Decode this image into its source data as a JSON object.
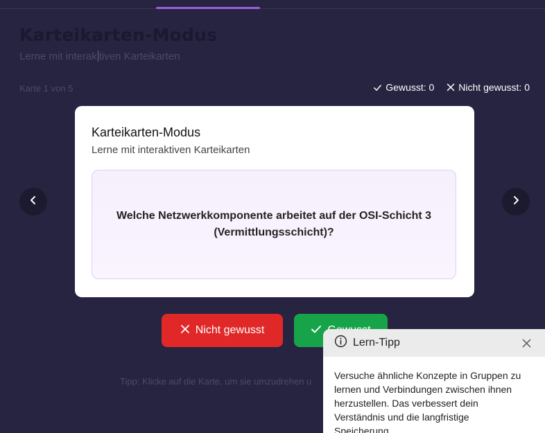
{
  "page": {
    "title": "Karteikarten-Modus",
    "subtitle_before_caret": "Lerne mit interak",
    "subtitle_after_caret": "tiven Karteikarten"
  },
  "progress": "Karte 1 von 5",
  "stats": {
    "known": "Gewusst: 0",
    "unknown": "Nicht gewusst: 0"
  },
  "modal": {
    "title": "Karteikarten-Modus",
    "subtitle": "Lerne mit interaktiven Karteikarten",
    "question": "Welche Netzwerkkomponente arbeitet auf der OSI-Schicht 3 (Vermittlungsschicht)?"
  },
  "buttons": {
    "not_known": "Nicht gewusst",
    "known": "Gewusst"
  },
  "hint": "Tipp: Klicke auf die Karte, um sie umzudrehen u",
  "toast": {
    "title": "Lern-Tipp",
    "body": "Versuche ähnliche Konzepte in Gruppen zu lernen und Verbindungen zwischen ihnen herzustellen. Das verbessert dein Verständnis und die langfristige Speicherung."
  },
  "icons": {
    "check": "check-icon",
    "x": "x-icon",
    "chevron_left": "chevron-left-icon",
    "chevron_right": "chevron-right-icon",
    "info": "info-icon",
    "close": "close-icon"
  },
  "colors": {
    "background": "#262441",
    "accent": "#9b62e0",
    "danger": "#e02828",
    "success": "#17a34a"
  }
}
